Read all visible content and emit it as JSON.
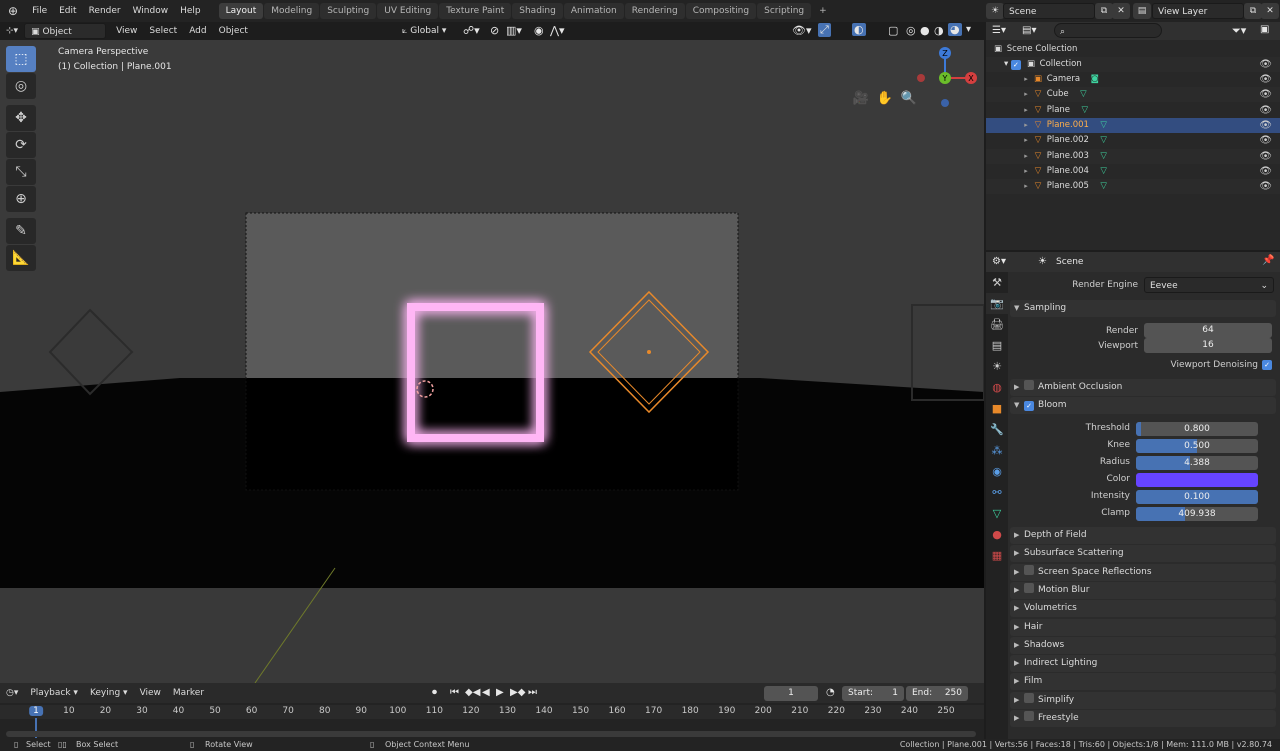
{
  "topbar": {
    "menus": [
      "File",
      "Edit",
      "Render",
      "Window",
      "Help"
    ],
    "workspace_tabs": [
      "Layout",
      "Modeling",
      "Sculpting",
      "UV Editing",
      "Texture Paint",
      "Shading",
      "Animation",
      "Rendering",
      "Compositing",
      "Scripting"
    ],
    "active_tab": "Layout",
    "add_tab": "+",
    "scene": "Scene",
    "view_layer": "View Layer"
  },
  "viewport_header": {
    "mode": "Object Mode",
    "menus": [
      "View",
      "Select",
      "Add",
      "Object"
    ],
    "orientation": "Global"
  },
  "viewport": {
    "title": "Camera Perspective",
    "subtitle": "(1) Collection | Plane.001",
    "gizmo": {
      "z": "Z",
      "y": "Y",
      "x": "X"
    },
    "neon_color": "#ff9ff0",
    "selected_color": "#e8892a"
  },
  "outliner": {
    "root": "Scene Collection",
    "collection": "Collection",
    "items": [
      {
        "name": "Camera",
        "kind": "camera"
      },
      {
        "name": "Cube",
        "kind": "mesh"
      },
      {
        "name": "Plane",
        "kind": "mesh"
      },
      {
        "name": "Plane.001",
        "kind": "mesh",
        "selected": true
      },
      {
        "name": "Plane.002",
        "kind": "mesh"
      },
      {
        "name": "Plane.003",
        "kind": "mesh"
      },
      {
        "name": "Plane.004",
        "kind": "mesh"
      },
      {
        "name": "Plane.005",
        "kind": "mesh"
      }
    ]
  },
  "properties": {
    "context": "Scene",
    "render_engine_label": "Render Engine",
    "render_engine": "Eevee",
    "sampling": {
      "title": "Sampling",
      "render_label": "Render",
      "render": "64",
      "viewport_label": "Viewport",
      "viewport": "16",
      "denoise_label": "Viewport Denoising"
    },
    "ambient_occlusion": "Ambient Occlusion",
    "bloom": {
      "title": "Bloom",
      "fields": [
        {
          "label": "Threshold",
          "value": "0.800",
          "fill": 0.04
        },
        {
          "label": "Knee",
          "value": "0.500",
          "fill": 0.5
        },
        {
          "label": "Radius",
          "value": "4.388",
          "fill": 0.44
        },
        {
          "label": "Color",
          "value": "",
          "color": "#6644ff"
        },
        {
          "label": "Intensity",
          "value": "0.100",
          "fill": 1.0
        },
        {
          "label": "Clamp",
          "value": "409.938",
          "fill": 0.4
        }
      ]
    },
    "sections": [
      {
        "label": "Depth of Field",
        "checkbox": false
      },
      {
        "label": "Subsurface Scattering",
        "checkbox": false
      },
      {
        "label": "Screen Space Reflections",
        "checkbox": true
      },
      {
        "label": "Motion Blur",
        "checkbox": true
      },
      {
        "label": "Volumetrics",
        "checkbox": false
      },
      {
        "label": "Hair",
        "checkbox": false
      },
      {
        "label": "Shadows",
        "checkbox": false
      },
      {
        "label": "Indirect Lighting",
        "checkbox": false
      },
      {
        "label": "Film",
        "checkbox": false
      },
      {
        "label": "Simplify",
        "checkbox": true
      },
      {
        "label": "Freestyle",
        "checkbox": true
      }
    ]
  },
  "timeline": {
    "menus": [
      "Playback",
      "Keying",
      "View",
      "Marker"
    ],
    "current_frame": "1",
    "start_label": "Start:",
    "start": "1",
    "end_label": "End:",
    "end": "250",
    "frames": [
      1,
      10,
      20,
      30,
      40,
      50,
      60,
      70,
      80,
      90,
      100,
      110,
      120,
      130,
      140,
      150,
      160,
      170,
      180,
      190,
      200,
      210,
      220,
      230,
      240,
      250
    ]
  },
  "statusbar": {
    "select": "Select",
    "box_select": "Box Select",
    "rotate_view": "Rotate View",
    "context_menu": "Object Context Menu",
    "stats": "Collection | Plane.001 | Verts:56 | Faces:18 | Tris:60 | Objects:1/8 | Mem: 111.0 MB | v2.80.74"
  }
}
